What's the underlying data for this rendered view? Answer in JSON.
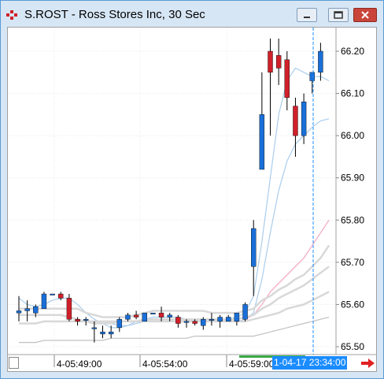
{
  "window": {
    "title": "S.ROST - Ross Stores Inc, 30 Sec"
  },
  "colors": {
    "up": "#1a6fd8",
    "down": "#d0202a",
    "wick": "#000000",
    "ma_blue": "#a9cdec",
    "ma_pink": "#f0a7c2",
    "ma_gray": "#d8d8d8",
    "ma_gray2": "#c0c0c0",
    "cursor": "#1a8cff",
    "scroll_arrow": "#e02020"
  },
  "icons": {
    "app": "chart-app-icon",
    "minimize": "minimize-icon",
    "maximize": "maximize-icon",
    "close": "close-icon",
    "scroll_right": "red-arrow-right-icon"
  },
  "x_axis": {
    "labels": [
      "4-05:49:00",
      "4-05:54:00",
      "4-05:59:00"
    ],
    "cursor_label": "1-04-17 23:34:00"
  },
  "chart_data": {
    "type": "candlestick",
    "y_ticks": [
      "66.20",
      "66.10",
      "66.00",
      "65.90",
      "65.80",
      "65.70",
      "65.60",
      "65.50"
    ],
    "ylim": [
      65.49,
      66.27
    ],
    "grid": true,
    "candles": [
      {
        "o": 65.58,
        "h": 65.62,
        "l": 65.56,
        "c": 65.585
      },
      {
        "o": 65.585,
        "h": 65.61,
        "l": 65.56,
        "c": 65.59
      },
      {
        "o": 65.58,
        "h": 65.6,
        "l": 65.57,
        "c": 65.595
      },
      {
        "o": 65.59,
        "h": 65.63,
        "l": 65.59,
        "c": 65.625
      },
      {
        "o": 65.625,
        "h": 65.625,
        "l": 65.625,
        "c": 65.625
      },
      {
        "o": 65.625,
        "h": 65.63,
        "l": 65.61,
        "c": 65.615
      },
      {
        "o": 65.615,
        "h": 65.625,
        "l": 65.56,
        "c": 65.565
      },
      {
        "o": 65.565,
        "h": 65.57,
        "l": 65.55,
        "c": 65.56
      },
      {
        "o": 65.565,
        "h": 65.57,
        "l": 65.55,
        "c": 65.565
      },
      {
        "o": 65.545,
        "h": 65.56,
        "l": 65.51,
        "c": 65.545
      },
      {
        "o": 65.53,
        "h": 65.55,
        "l": 65.52,
        "c": 65.535
      },
      {
        "o": 65.53,
        "h": 65.55,
        "l": 65.52,
        "c": 65.535
      },
      {
        "o": 65.545,
        "h": 65.57,
        "l": 65.535,
        "c": 65.565
      },
      {
        "o": 65.565,
        "h": 65.58,
        "l": 65.56,
        "c": 65.575
      },
      {
        "o": 65.575,
        "h": 65.585,
        "l": 65.565,
        "c": 65.57
      },
      {
        "o": 65.56,
        "h": 65.58,
        "l": 65.56,
        "c": 65.58
      },
      {
        "o": 65.58,
        "h": 65.58,
        "l": 65.58,
        "c": 65.58
      },
      {
        "o": 65.58,
        "h": 65.595,
        "l": 65.56,
        "c": 65.57
      },
      {
        "o": 65.57,
        "h": 65.58,
        "l": 65.56,
        "c": 65.575
      },
      {
        "o": 65.57,
        "h": 65.575,
        "l": 65.545,
        "c": 65.555
      },
      {
        "o": 65.56,
        "h": 65.565,
        "l": 65.545,
        "c": 65.56
      },
      {
        "o": 65.56,
        "h": 65.565,
        "l": 65.55,
        "c": 65.555
      },
      {
        "o": 65.55,
        "h": 65.57,
        "l": 65.54,
        "c": 65.565
      },
      {
        "o": 65.565,
        "h": 65.58,
        "l": 65.55,
        "c": 65.565
      },
      {
        "o": 65.56,
        "h": 65.575,
        "l": 65.545,
        "c": 65.57
      },
      {
        "o": 65.56,
        "h": 65.575,
        "l": 65.56,
        "c": 65.57
      },
      {
        "o": 65.56,
        "h": 65.58,
        "l": 65.55,
        "c": 65.58
      },
      {
        "o": 65.565,
        "h": 65.605,
        "l": 65.56,
        "c": 65.6
      },
      {
        "o": 65.69,
        "h": 65.8,
        "l": 65.62,
        "c": 65.78
      },
      {
        "o": 65.92,
        "h": 66.15,
        "l": 65.92,
        "c": 66.05
      },
      {
        "o": 66.2,
        "h": 66.23,
        "l": 66.0,
        "c": 66.15
      },
      {
        "o": 66.19,
        "h": 66.23,
        "l": 66.12,
        "c": 66.16
      },
      {
        "o": 66.18,
        "h": 66.2,
        "l": 66.06,
        "c": 66.09
      },
      {
        "o": 66.07,
        "h": 66.09,
        "l": 65.95,
        "c": 66.0
      },
      {
        "o": 66.0,
        "h": 66.1,
        "l": 65.98,
        "c": 66.08
      },
      {
        "o": 66.13,
        "h": 66.15,
        "l": 66.1,
        "c": 66.15
      },
      {
        "o": 66.15,
        "h": 66.22,
        "l": 66.13,
        "c": 66.2
      }
    ],
    "indicators": [
      {
        "color": "ma_blue",
        "values": [
          65.615,
          65.6,
          65.595,
          65.6,
          65.61,
          65.615,
          65.615,
          65.6,
          65.58,
          65.565,
          65.555,
          65.545,
          65.545,
          65.55,
          65.56,
          65.565,
          65.57,
          65.57,
          65.57,
          65.57,
          65.565,
          65.56,
          65.56,
          65.56,
          65.56,
          65.565,
          65.57,
          65.58,
          65.62,
          65.75,
          65.9,
          66.05,
          66.13,
          66.16,
          66.15,
          66.14,
          66.14,
          66.13
        ]
      },
      {
        "color": "ma_blue",
        "values": [
          null,
          null,
          null,
          null,
          null,
          null,
          null,
          null,
          null,
          null,
          65.56,
          65.555,
          65.55,
          65.55,
          65.555,
          65.56,
          65.565,
          65.565,
          65.565,
          65.565,
          65.565,
          65.565,
          65.56,
          65.56,
          65.56,
          65.56,
          65.56,
          65.565,
          65.58,
          65.66,
          65.77,
          65.87,
          65.94,
          65.98,
          66.0,
          66.02,
          66.035,
          66.04
        ]
      },
      {
        "color": "ma_pink",
        "values": [
          null,
          null,
          null,
          null,
          null,
          null,
          null,
          null,
          null,
          null,
          null,
          null,
          null,
          null,
          null,
          null,
          null,
          null,
          null,
          null,
          null,
          null,
          null,
          null,
          null,
          null,
          null,
          65.565,
          65.575,
          65.6,
          65.63,
          65.65,
          65.67,
          65.69,
          65.71,
          65.74,
          65.77,
          65.8
        ]
      },
      {
        "color": "ma_gray",
        "values": [
          65.59,
          65.59,
          65.59,
          65.59,
          65.59,
          65.59,
          65.59,
          65.59,
          65.58,
          65.575,
          65.57,
          65.57,
          65.57,
          65.57,
          65.575,
          65.58,
          65.585,
          65.585,
          65.585,
          65.585,
          65.585,
          65.585,
          65.585,
          65.58,
          65.58,
          65.58,
          65.58,
          65.585,
          65.59,
          65.61,
          65.62,
          65.635,
          65.645,
          65.66,
          65.67,
          65.69,
          65.71,
          65.74
        ]
      },
      {
        "color": "ma_gray",
        "values": [
          65.575,
          65.575,
          65.575,
          65.575,
          65.575,
          65.575,
          65.57,
          65.565,
          65.56,
          65.555,
          65.555,
          65.555,
          65.56,
          65.56,
          65.56,
          65.565,
          65.565,
          65.565,
          65.565,
          65.565,
          65.565,
          65.565,
          65.565,
          65.565,
          65.565,
          65.565,
          65.565,
          65.57,
          65.575,
          65.59,
          65.6,
          65.615,
          65.625,
          65.635,
          65.645,
          65.66,
          65.675,
          65.69
        ]
      },
      {
        "color": "ma_gray2",
        "values": [
          65.51,
          65.51,
          65.51,
          65.515,
          65.515,
          65.515,
          65.515,
          65.515,
          65.515,
          65.515,
          65.515,
          65.52,
          65.52,
          65.52,
          65.52,
          65.52,
          65.52,
          65.52,
          65.52,
          65.52,
          65.52,
          65.525,
          65.525,
          65.525,
          65.525,
          65.525,
          65.525,
          65.525,
          65.525,
          65.53,
          65.535,
          65.54,
          65.545,
          65.55,
          65.555,
          65.56,
          65.565,
          65.57
        ]
      },
      {
        "color": "ma_gray",
        "values": [
          65.555,
          65.555,
          65.555,
          65.56,
          65.56,
          65.56,
          65.56,
          65.56,
          65.56,
          65.56,
          65.56,
          65.56,
          65.56,
          65.56,
          65.56,
          65.56,
          65.56,
          65.56,
          65.56,
          65.56,
          65.56,
          65.56,
          65.56,
          65.56,
          65.56,
          65.56,
          65.56,
          65.56,
          65.565,
          65.57,
          65.575,
          65.58,
          65.59,
          65.595,
          65.6,
          65.61,
          65.62,
          65.63
        ]
      }
    ]
  }
}
